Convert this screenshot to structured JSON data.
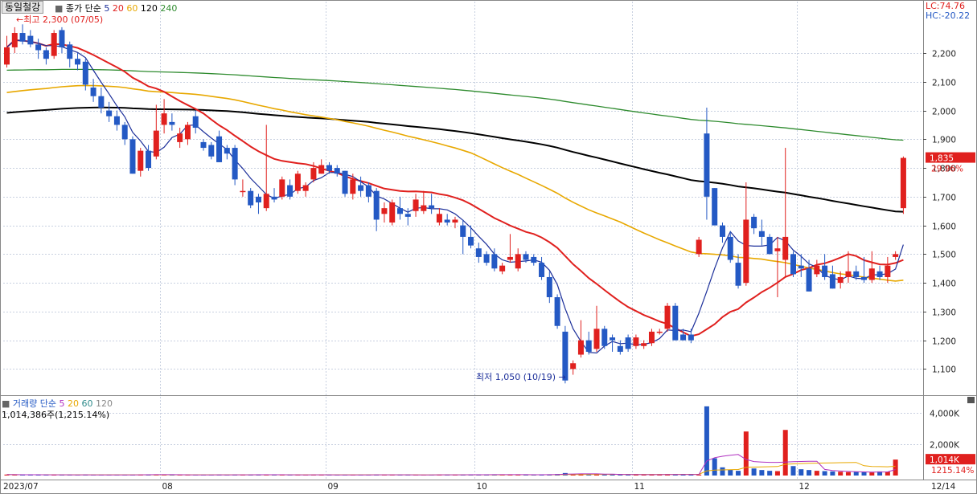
{
  "header": {
    "stock_name": "동일철강",
    "price_label": "종가 단순",
    "ma_periods": [
      "5",
      "20",
      "60",
      "120",
      "240"
    ],
    "lc": "LC:74.76",
    "hc": "HC:-20.22"
  },
  "annotations": {
    "high": "←최고 2,300 (07/05)",
    "low": "최저 1,050 (10/19) →",
    "last_price": "1,835",
    "last_change": "29.96%"
  },
  "volume_header": {
    "label": "거래량",
    "price_label": "단순",
    "ma_periods": [
      "5",
      "20",
      "60",
      "120"
    ],
    "current": "1,014,386주(1,215.14%)",
    "last_tag": "1,014K",
    "last_pct": "1215.14%"
  },
  "colors": {
    "up": "#e0201e",
    "down": "#2459c4",
    "ma5": "#1c2f9a",
    "ma20": "#e0201e",
    "ma60": "#e8a800",
    "ma120": "#000000",
    "ma240": "#2e8b2e",
    "grid": "#c8d0e0"
  },
  "chart_data": {
    "type": "candlestick",
    "y_ticks": [
      1100,
      1200,
      1300,
      1400,
      1500,
      1600,
      1700,
      1800,
      1900,
      2000,
      2100,
      2200
    ],
    "y_tick_labels": [
      "1,100",
      "1,200",
      "1,300",
      "1,400",
      "1,500",
      "1,600",
      "1,700",
      "1,800",
      "1,900",
      "2,000",
      "2,100",
      "2,200"
    ],
    "ylim": [
      1020,
      2340
    ],
    "x_labels": [
      {
        "label": "2023/07",
        "index": 0
      },
      {
        "label": "08",
        "index": 20
      },
      {
        "label": "09",
        "index": 41
      },
      {
        "label": "10",
        "index": 60
      },
      {
        "label": "11",
        "index": 80
      },
      {
        "label": "12",
        "index": 101
      },
      {
        "label": "12/14",
        "index": 112
      }
    ],
    "candles": [
      [
        2160,
        2260,
        2150,
        2220
      ],
      [
        2220,
        2290,
        2200,
        2270
      ],
      [
        2270,
        2300,
        2230,
        2240
      ],
      [
        2260,
        2280,
        2220,
        2230
      ],
      [
        2230,
        2250,
        2180,
        2210
      ],
      [
        2210,
        2220,
        2160,
        2180
      ],
      [
        2190,
        2280,
        2180,
        2270
      ],
      [
        2280,
        2290,
        2200,
        2220
      ],
      [
        2230,
        2240,
        2150,
        2180
      ],
      [
        2180,
        2200,
        2140,
        2160
      ],
      [
        2170,
        2180,
        2070,
        2090
      ],
      [
        2080,
        2110,
        2030,
        2050
      ],
      [
        2050,
        2080,
        1990,
        2010
      ],
      [
        2000,
        2030,
        1960,
        1980
      ],
      [
        1980,
        2000,
        1930,
        1950
      ],
      [
        1950,
        1960,
        1880,
        1900
      ],
      [
        1900,
        1910,
        1780,
        1780
      ],
      [
        1790,
        1870,
        1770,
        1860
      ],
      [
        1860,
        1880,
        1790,
        1800
      ],
      [
        1840,
        2020,
        1830,
        1930
      ],
      [
        1950,
        2040,
        1920,
        1990
      ],
      [
        1960,
        1990,
        1930,
        1950
      ],
      [
        1890,
        1940,
        1870,
        1920
      ],
      [
        1900,
        1960,
        1880,
        1950
      ],
      [
        1980,
        2000,
        1920,
        1940
      ],
      [
        1890,
        1900,
        1860,
        1870
      ],
      [
        1880,
        1890,
        1830,
        1840
      ],
      [
        1910,
        1930,
        1820,
        1820
      ],
      [
        1870,
        1880,
        1830,
        1850
      ],
      [
        1870,
        1880,
        1740,
        1760
      ],
      [
        1720,
        1760,
        1700,
        1720
      ],
      [
        1720,
        1730,
        1660,
        1670
      ],
      [
        1700,
        1710,
        1640,
        1680
      ],
      [
        1660,
        1950,
        1650,
        1710
      ],
      [
        1700,
        1730,
        1680,
        1690
      ],
      [
        1700,
        1770,
        1690,
        1760
      ],
      [
        1740,
        1760,
        1690,
        1700
      ],
      [
        1720,
        1790,
        1710,
        1780
      ],
      [
        1720,
        1750,
        1700,
        1740
      ],
      [
        1760,
        1820,
        1750,
        1800
      ],
      [
        1780,
        1830,
        1780,
        1810
      ],
      [
        1810,
        1820,
        1780,
        1790
      ],
      [
        1800,
        1810,
        1770,
        1780
      ],
      [
        1790,
        1790,
        1700,
        1710
      ],
      [
        1710,
        1780,
        1690,
        1760
      ],
      [
        1740,
        1770,
        1700,
        1720
      ],
      [
        1740,
        1750,
        1680,
        1700
      ],
      [
        1720,
        1730,
        1580,
        1620
      ],
      [
        1640,
        1680,
        1610,
        1660
      ],
      [
        1610,
        1690,
        1600,
        1680
      ],
      [
        1660,
        1700,
        1620,
        1640
      ],
      [
        1640,
        1660,
        1600,
        1630
      ],
      [
        1650,
        1710,
        1630,
        1690
      ],
      [
        1650,
        1720,
        1640,
        1670
      ],
      [
        1670,
        1710,
        1640,
        1660
      ],
      [
        1610,
        1660,
        1600,
        1640
      ],
      [
        1620,
        1640,
        1600,
        1610
      ],
      [
        1610,
        1630,
        1590,
        1620
      ],
      [
        1600,
        1620,
        1500,
        1560
      ],
      [
        1560,
        1600,
        1520,
        1530
      ],
      [
        1520,
        1540,
        1470,
        1490
      ],
      [
        1500,
        1510,
        1460,
        1470
      ],
      [
        1500,
        1520,
        1440,
        1450
      ],
      [
        1440,
        1470,
        1430,
        1460
      ],
      [
        1480,
        1570,
        1470,
        1490
      ],
      [
        1450,
        1520,
        1440,
        1500
      ],
      [
        1500,
        1510,
        1470,
        1480
      ],
      [
        1490,
        1500,
        1460,
        1470
      ],
      [
        1470,
        1490,
        1410,
        1420
      ],
      [
        1420,
        1440,
        1330,
        1350
      ],
      [
        1350,
        1360,
        1240,
        1250
      ],
      [
        1230,
        1250,
        1050,
        1060
      ],
      [
        1100,
        1130,
        1080,
        1120
      ],
      [
        1150,
        1270,
        1140,
        1200
      ],
      [
        1200,
        1230,
        1150,
        1160
      ],
      [
        1170,
        1320,
        1160,
        1240
      ],
      [
        1240,
        1250,
        1170,
        1180
      ],
      [
        1210,
        1220,
        1160,
        1200
      ],
      [
        1180,
        1200,
        1150,
        1160
      ],
      [
        1210,
        1220,
        1160,
        1170
      ],
      [
        1180,
        1220,
        1170,
        1210
      ],
      [
        1180,
        1200,
        1170,
        1190
      ],
      [
        1190,
        1240,
        1180,
        1230
      ],
      [
        1230,
        1240,
        1220,
        1230
      ],
      [
        1240,
        1330,
        1230,
        1320
      ],
      [
        1320,
        1330,
        1200,
        1200
      ],
      [
        1220,
        1240,
        1200,
        1200
      ],
      [
        1220,
        1240,
        1190,
        1200
      ],
      [
        1500,
        1560,
        1490,
        1550
      ],
      [
        1920,
        2010,
        1620,
        1700
      ],
      [
        1730,
        1730,
        1610,
        1600
      ],
      [
        1600,
        1610,
        1540,
        1560
      ],
      [
        1560,
        1580,
        1470,
        1480
      ],
      [
        1470,
        1500,
        1380,
        1390
      ],
      [
        1400,
        1750,
        1390,
        1620
      ],
      [
        1630,
        1640,
        1570,
        1590
      ],
      [
        1580,
        1620,
        1530,
        1560
      ],
      [
        1560,
        1570,
        1500,
        1500
      ],
      [
        1510,
        1560,
        1350,
        1520
      ],
      [
        1480,
        1870,
        1420,
        1560
      ],
      [
        1500,
        1510,
        1420,
        1430
      ],
      [
        1460,
        1500,
        1420,
        1450
      ],
      [
        1450,
        1480,
        1370,
        1370
      ],
      [
        1430,
        1480,
        1420,
        1460
      ],
      [
        1460,
        1500,
        1410,
        1420
      ],
      [
        1430,
        1460,
        1380,
        1380
      ],
      [
        1400,
        1440,
        1380,
        1420
      ],
      [
        1420,
        1510,
        1400,
        1440
      ],
      [
        1440,
        1460,
        1410,
        1420
      ],
      [
        1420,
        1490,
        1400,
        1410
      ],
      [
        1410,
        1510,
        1400,
        1450
      ],
      [
        1440,
        1460,
        1410,
        1420
      ],
      [
        1420,
        1490,
        1400,
        1460
      ],
      [
        1490,
        1510,
        1480,
        1500
      ],
      [
        1660,
        1840,
        1640,
        1835
      ]
    ],
    "volume": [
      60,
      50,
      45,
      40,
      55,
      45,
      50,
      40,
      45,
      35,
      55,
      40,
      35,
      30,
      45,
      50,
      40,
      60,
      55,
      70,
      45,
      40,
      35,
      50,
      40,
      45,
      40,
      45,
      38,
      52,
      48,
      55,
      50,
      60,
      40,
      45,
      42,
      48,
      40,
      50,
      38,
      45,
      42,
      40,
      35,
      50,
      40,
      55,
      42,
      40,
      45,
      38,
      50,
      42,
      40,
      55,
      45,
      40,
      60,
      55,
      50,
      45,
      60,
      65,
      55,
      50,
      45,
      40,
      70,
      75,
      90,
      160,
      80,
      120,
      85,
      100,
      70,
      60,
      50,
      55,
      60,
      50,
      65,
      60,
      75,
      70,
      50,
      55,
      60,
      4400,
      1100,
      520,
      380,
      300,
      2800,
      450,
      350,
      300,
      280,
      2900,
      600,
      400,
      350,
      300,
      280,
      260,
      240,
      220,
      230,
      210,
      200,
      260,
      240,
      1014
    ]
  },
  "volume_chart": {
    "ticks": [
      2000,
      4000
    ],
    "tick_labels": [
      "2,000K",
      "4,000K"
    ],
    "ylim": [
      0,
      4700
    ]
  }
}
